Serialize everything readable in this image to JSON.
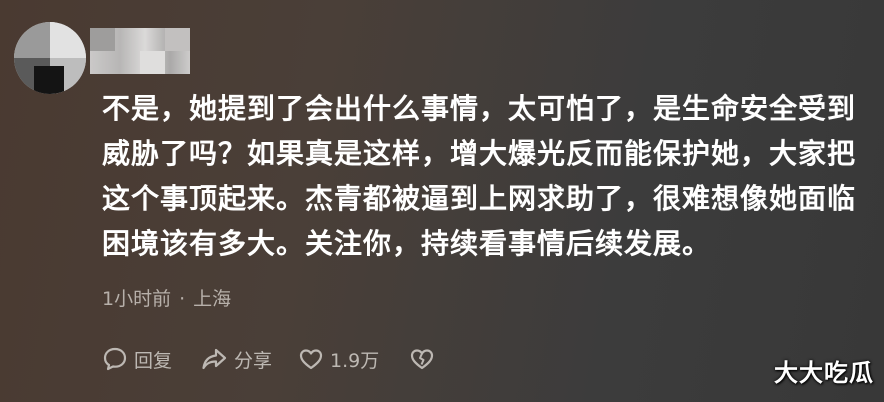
{
  "comment": {
    "lines": [
      "不是，她提到了会出什么事情，太可怕了，是生命安全受到",
      "威胁了吗？如果真是这样，增大爆光反而能保护她，大家把",
      "这个事顶起来。杰青都被逼到上网求助了，很难想像她面临",
      "困境该有多大。关注你，持续看事情后续发展。"
    ],
    "time": "1小时前",
    "separator": "·",
    "location": "上海"
  },
  "actions": {
    "reply_label": "回复",
    "share_label": "分享",
    "like_count": "1.9万"
  },
  "watermark": "大大吃瓜",
  "icons": {
    "reply": "comment-bubble-icon",
    "share": "share-arrow-icon",
    "like": "heart-icon",
    "dislike": "broken-heart-icon"
  }
}
